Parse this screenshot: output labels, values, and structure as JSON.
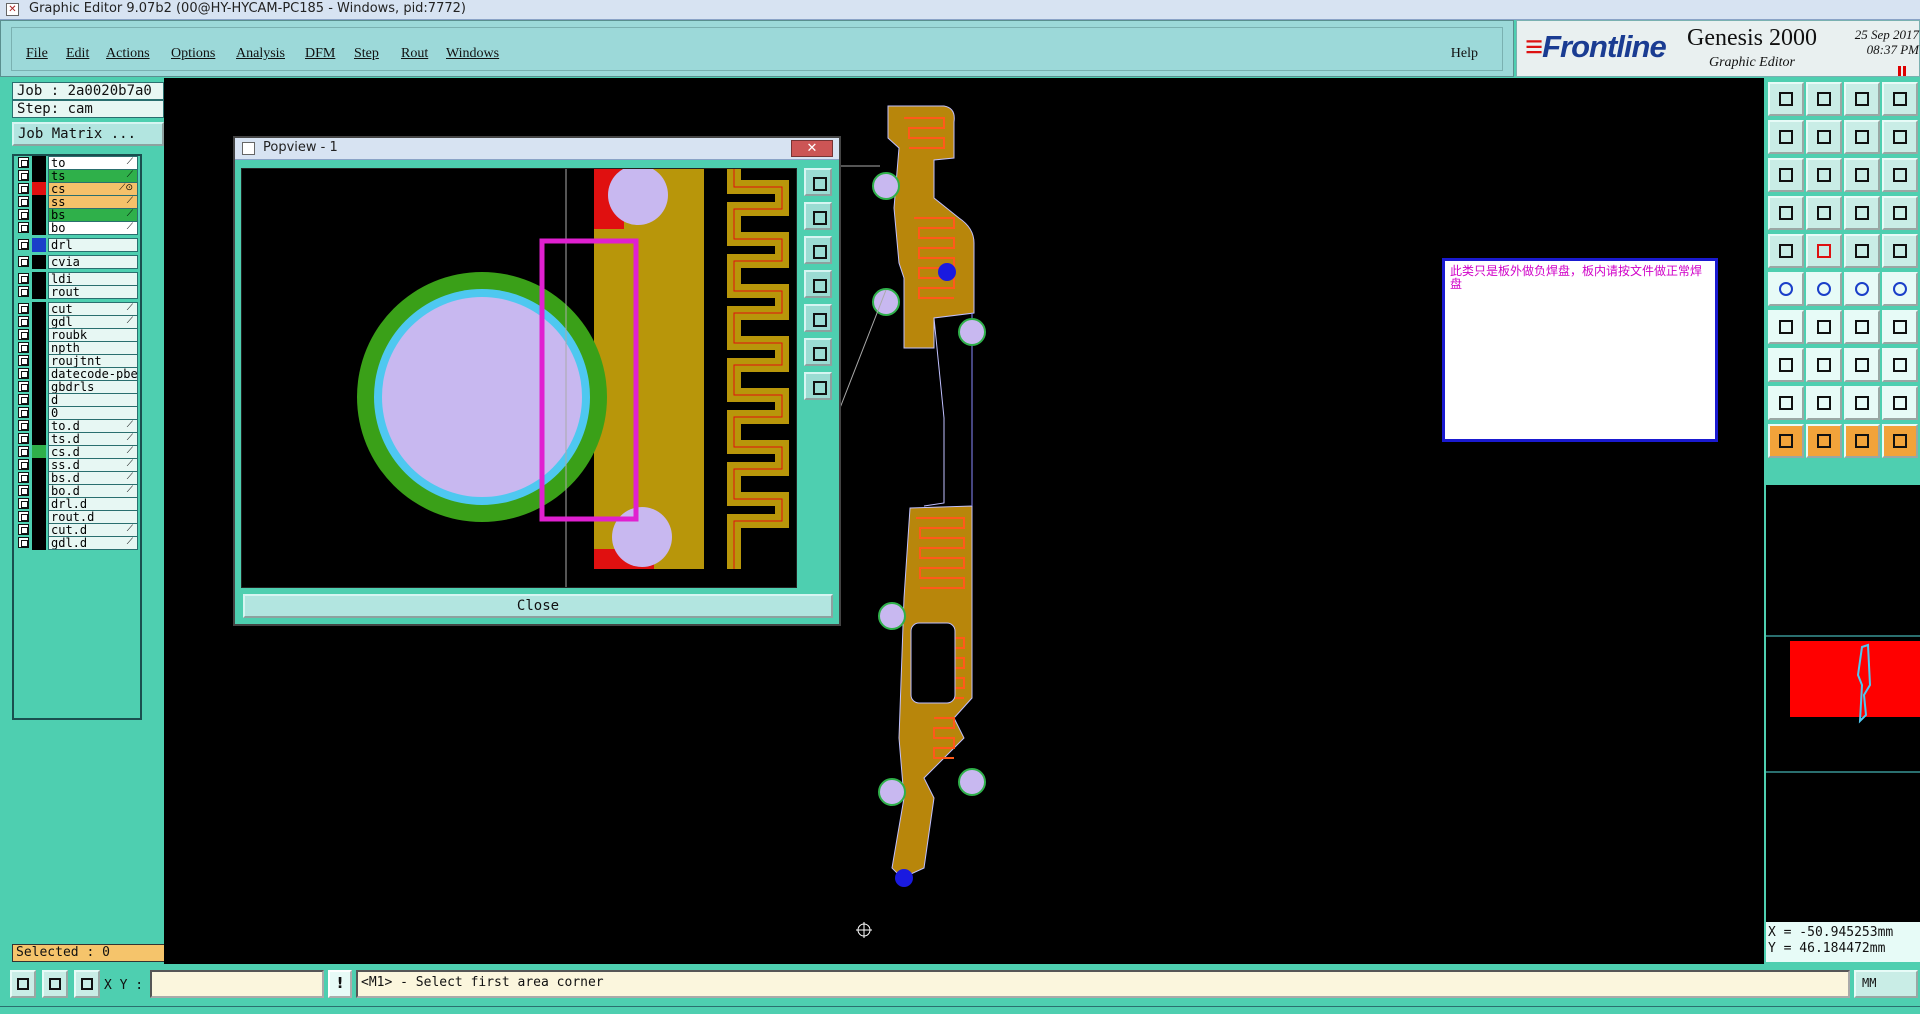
{
  "window": {
    "title": "Graphic Editor 9.07b2 (00@HY-HYCAM-PC185 - Windows, pid:7772)"
  },
  "menu": [
    "File",
    "Edit",
    "Actions",
    "Options",
    "Analysis",
    "DFM",
    "Step",
    "Rout",
    "Windows"
  ],
  "help_label": "Help",
  "brand": {
    "logo": "Frontline",
    "product": "Genesis 2000",
    "subtitle": "Graphic Editor",
    "date": "25 Sep 2017",
    "time": "08:37 PM"
  },
  "job": {
    "job_line": "Job : 2a0020b7a0",
    "step_line": "Step: cam",
    "matrix_button": "Job Matrix ..."
  },
  "layers": [
    {
      "name": "to",
      "color": "#ffffff",
      "flag": "⟋"
    },
    {
      "name": "ts",
      "color": "#2fb04a",
      "flag": "⟋"
    },
    {
      "name": "cs",
      "color": "#f5c16a",
      "flag": "⟋⊙"
    },
    {
      "name": "ss",
      "color": "#f5c16a",
      "flag": "⟋"
    },
    {
      "name": "bs",
      "color": "#2fb04a",
      "flag": "⟋"
    },
    {
      "name": "bo",
      "color": "#ffffff",
      "flag": "⟋"
    },
    {
      "name": "drl",
      "color": "#e7f7f3",
      "flag": ""
    },
    {
      "name": "cvia",
      "color": "#e7f7f3",
      "flag": ""
    },
    {
      "name": "ldi",
      "color": "#e7f7f3",
      "flag": ""
    },
    {
      "name": "rout",
      "color": "#e7f7f3",
      "flag": ""
    },
    {
      "name": "cut",
      "color": "#e7f7f3",
      "flag": "⟋"
    },
    {
      "name": "gdl",
      "color": "#e7f7f3",
      "flag": "⟋"
    },
    {
      "name": "roubk",
      "color": "#e7f7f3",
      "flag": ""
    },
    {
      "name": "npth",
      "color": "#e7f7f3",
      "flag": ""
    },
    {
      "name": "roujtnt",
      "color": "#e7f7f3",
      "flag": ""
    },
    {
      "name": "datecode-pbe",
      "color": "#e7f7f3",
      "flag": ""
    },
    {
      "name": "gbdrls",
      "color": "#e7f7f3",
      "flag": ""
    },
    {
      "name": "d",
      "color": "#e7f7f3",
      "flag": ""
    },
    {
      "name": "0",
      "color": "#e7f7f3",
      "flag": ""
    },
    {
      "name": "to.d",
      "color": "#e7f7f3",
      "flag": "⟋"
    },
    {
      "name": "ts.d",
      "color": "#e7f7f3",
      "flag": "⟋"
    },
    {
      "name": "cs.d",
      "color": "#e7f7f3",
      "flag": "⟋"
    },
    {
      "name": "ss.d",
      "color": "#e7f7f3",
      "flag": "⟋"
    },
    {
      "name": "bs.d",
      "color": "#e7f7f3",
      "flag": "⟋"
    },
    {
      "name": "bo.d",
      "color": "#e7f7f3",
      "flag": "⟋"
    },
    {
      "name": "drl.d",
      "color": "#e7f7f3",
      "flag": ""
    },
    {
      "name": "rout.d",
      "color": "#e7f7f3",
      "flag": ""
    },
    {
      "name": "cut.d",
      "color": "#e7f7f3",
      "flag": "⟋"
    },
    {
      "name": "gdl.d",
      "color": "#e7f7f3",
      "flag": "⟋"
    }
  ],
  "selected_label": "Selected : 0",
  "popview": {
    "title": "Popview - 1",
    "close_button": "Close",
    "close_x": "✕"
  },
  "note": "此类只是板外做负焊盘，板内请按文件做正常焊盘",
  "coords": {
    "x": "X = -50.945253mm",
    "y": "Y = 46.184472mm"
  },
  "bottom": {
    "xy_label": "X Y :",
    "status": "<M1> - Select first area corner",
    "unit": "MM",
    "excl": "!"
  }
}
